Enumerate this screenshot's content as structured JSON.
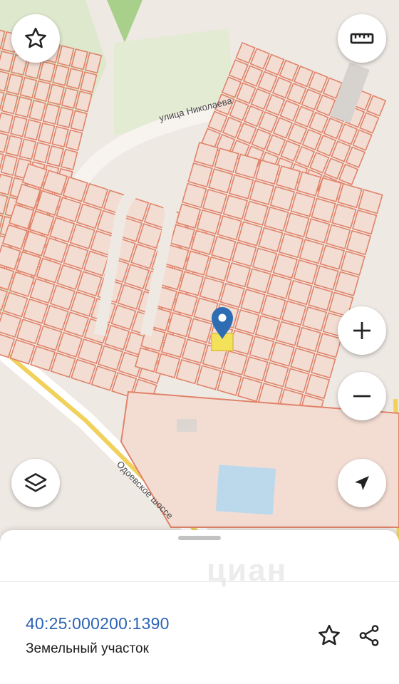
{
  "map": {
    "streets": {
      "nikolaeva": "улица Николаева",
      "odoevskoe": "Одоевское шоссе"
    },
    "colors": {
      "background": "#efe9e4",
      "parcel_fill": "#f3ddd3",
      "parcel_stroke": "#e0836a",
      "green_area": "#d4e3c2",
      "main_road": "#f0d873",
      "selected_parcel": "#f3e15a",
      "marker": "#2e6db4",
      "water": "#bcd9ec"
    }
  },
  "controls": {
    "favorite_icon": "star-outline",
    "ruler_icon": "ruler",
    "zoom_in_icon": "plus",
    "zoom_out_icon": "minus",
    "layers_icon": "layers",
    "location_icon": "navigation-arrow"
  },
  "sheet": {
    "cadastral_number": "40:25:000200:1390",
    "property_type": "Земельный участок",
    "watermark": "циан",
    "favorite_icon": "star-outline",
    "share_icon": "share"
  }
}
